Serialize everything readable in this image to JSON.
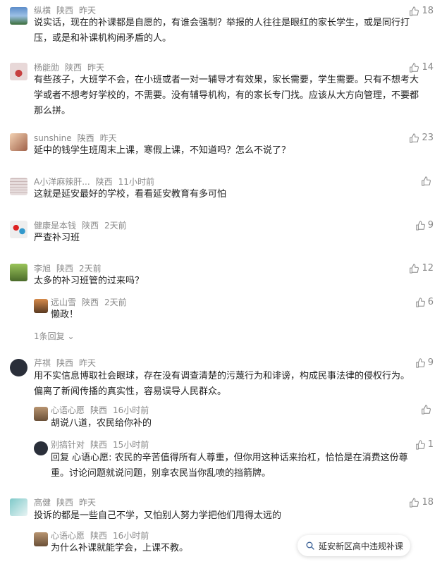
{
  "comments": [
    {
      "user": "纵横",
      "region": "陕西",
      "time": "昨天",
      "likes": "18",
      "text": [
        "说实话，现在的补课都是自愿的，有谁会强制？举报的人往往是眼红的家长学生，或是同行打",
        "压，或是和补课机构闹矛盾的人。"
      ]
    },
    {
      "user": "杨能勋",
      "region": "陕西",
      "time": "昨天",
      "likes": "14",
      "text": [
        "有些孩子，大班学不会，在小班或者一对一辅导才有效果，家长需要，学生需要。只有不想考大",
        "学或者不想考好学校的，不需要。没有辅导机构，有的家长专门找。应该从大方向管理，不要都",
        "那么拼。"
      ]
    },
    {
      "user": "sunshine",
      "region": "陕西",
      "time": "昨天",
      "likes": "23",
      "text": [
        "延中的钱学生班周末上课，寒假上课，不知道吗？怎么不说了？"
      ]
    },
    {
      "user": "A小洋麻辣肝...",
      "region": "陕西",
      "time": "11小时前",
      "likes": "",
      "text": [
        "这就是延安最好的学校，看看延安教育有多可怕"
      ]
    },
    {
      "user": "健康是本钱",
      "region": "陕西",
      "time": "2天前",
      "likes": "9",
      "text": [
        "严查补习班"
      ]
    },
    {
      "user": "李旭",
      "region": "陕西",
      "time": "2天前",
      "likes": "12",
      "text": [
        "太多的补习班管的过来吗？"
      ]
    },
    {
      "user": "芹祺",
      "region": "陕西",
      "time": "昨天",
      "likes": "9",
      "text": [
        "用不实信息博取社会眼球，存在没有调查清楚的污蔑行为和诽谤，构成民事法律的侵权行为。",
        "偏离了新闻传播的真实性，容易误导人民群众。"
      ]
    },
    {
      "user": "高健",
      "region": "陕西",
      "time": "昨天",
      "likes": "18",
      "text": [
        "投诉的都是一些自己不学，又怕别人努力学把他们甩得太远的"
      ]
    }
  ],
  "replies": [
    {
      "user": "远山雪",
      "region": "陕西",
      "time": "2天前",
      "likes": "6",
      "text": [
        "懒政！"
      ]
    },
    {
      "user": "心语心愿",
      "region": "陕西",
      "time": "16小时前",
      "likes": "",
      "text": [
        "胡说八道，农民给你补的"
      ]
    },
    {
      "user": "别搞针对",
      "region": "陕西",
      "time": "15小时前",
      "likes": "1",
      "text": [
        "回复 心语心愿: 农民的辛苦值得所有人尊重，但你用这种话来抬杠，恰恰是在消费这份尊",
        "重。讨论问题就说问题，别拿农民当你乱喷的挡箭牌。"
      ]
    },
    {
      "user": "心语心愿",
      "region": "陕西",
      "time": "16小时前",
      "likes": "",
      "text": [
        "为什么补课就能学会，上课不教。"
      ]
    }
  ],
  "more_replies_label": "1条回复",
  "search_label": "延安新区高中违规补课",
  "colors": {
    "meta": "#8a8a8a",
    "text": "#222222",
    "link": "#406599"
  },
  "icons": {
    "like": "thumbs-up-icon",
    "search": "search-icon",
    "chevron": "chevron-down-icon"
  }
}
